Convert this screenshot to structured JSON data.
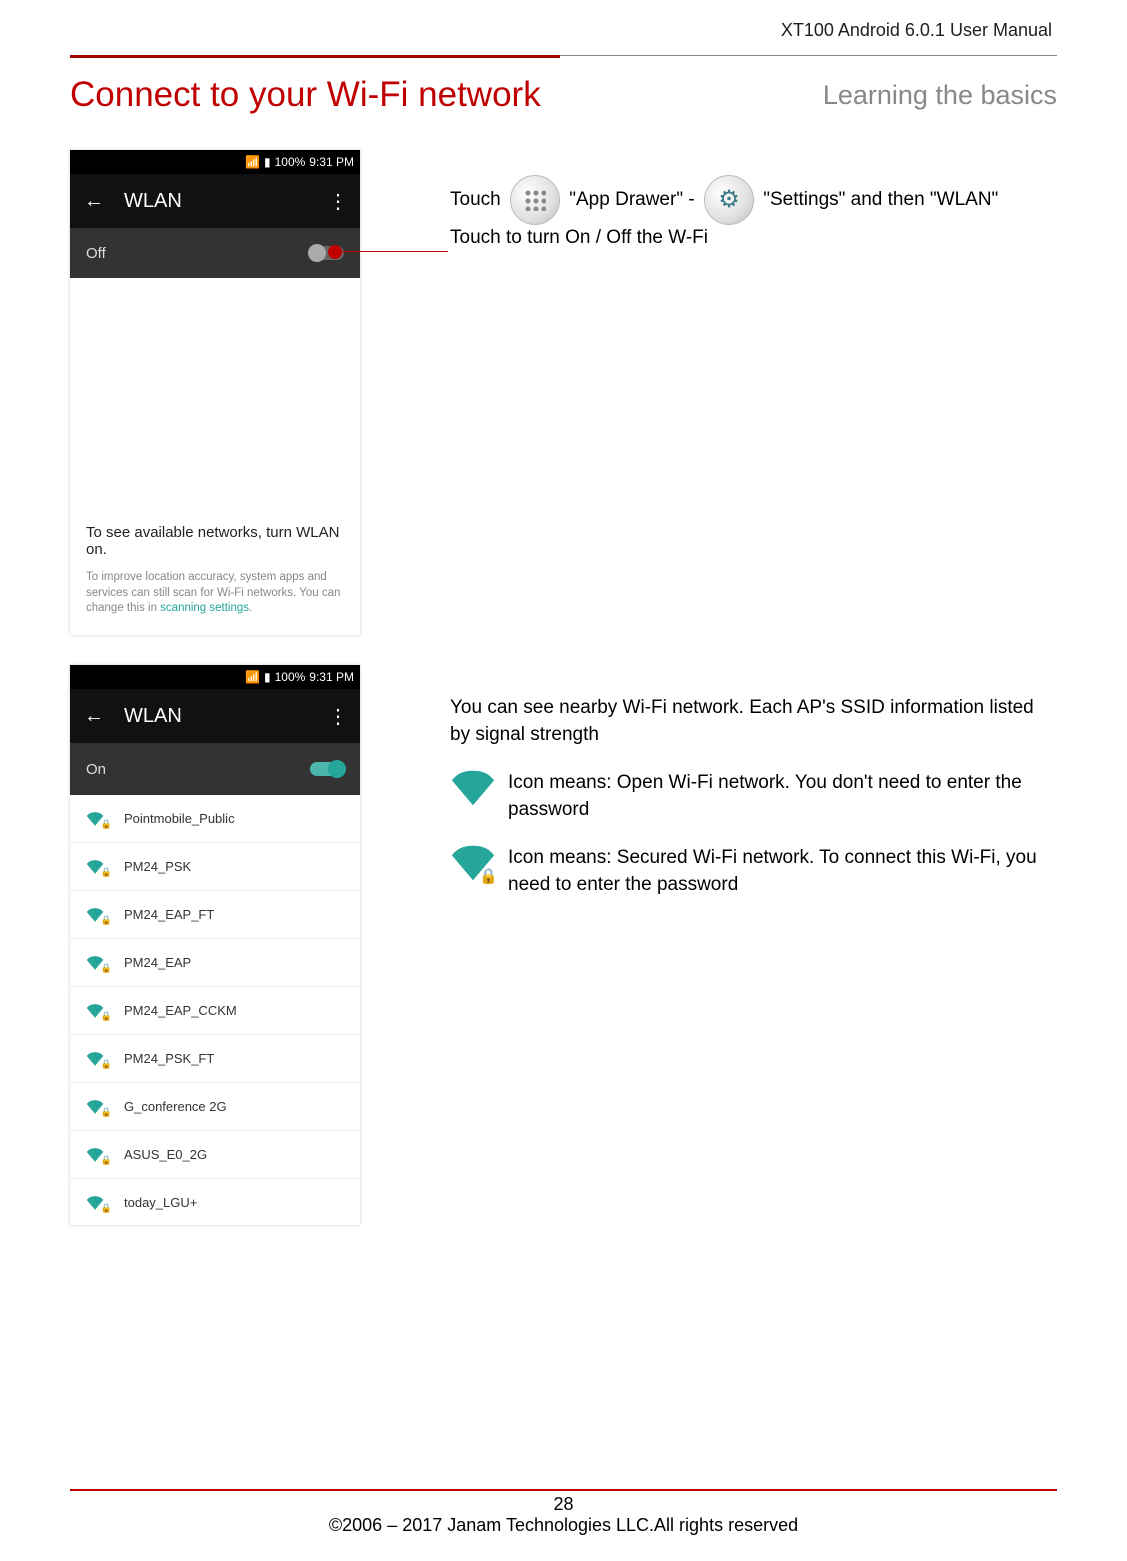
{
  "header": {
    "doc_title": "XT100 Android 6.0.1 User Manual"
  },
  "title": {
    "main": "Connect to your Wi-Fi network",
    "sub": "Learning the basics"
  },
  "phone1": {
    "status_time": "9:31 PM",
    "status_batt": "100%",
    "toolbar_title": "WLAN",
    "off_label": "Off",
    "msg1": "To see available networks, turn WLAN on.",
    "msg2a": "To improve location accuracy, system apps and services can still scan for Wi-Fi networks. You can change this in ",
    "msg2b": "scanning settings",
    "msg2c": "."
  },
  "instr1": {
    "t1": "Touch ",
    "t2": " \"App Drawer\" - ",
    "t3": " \"Settings\" and then \"WLAN\"",
    "t4": "Touch to turn On / Off the W-Fi"
  },
  "phone2": {
    "status_time": "9:31 PM",
    "status_batt": "100%",
    "toolbar_title": "WLAN",
    "on_label": "On",
    "networks": [
      {
        "name": "Pointmobile_Public",
        "secured": true
      },
      {
        "name": "PM24_PSK",
        "secured": true
      },
      {
        "name": "PM24_EAP_FT",
        "secured": true
      },
      {
        "name": "PM24_EAP",
        "secured": true
      },
      {
        "name": "PM24_EAP_CCKM",
        "secured": true
      },
      {
        "name": "PM24_PSK_FT",
        "secured": true
      },
      {
        "name": "G_conference 2G",
        "secured": true
      },
      {
        "name": "ASUS_E0_2G",
        "secured": true
      },
      {
        "name": "today_LGU+",
        "secured": true
      }
    ]
  },
  "instr2": {
    "p1": "You can see nearby Wi-Fi network. Each AP's SSID information listed by signal strength",
    "open_desc": "Icon means: Open Wi-Fi network. You don't need to enter the password",
    "sec_desc": "Icon means: Secured Wi-Fi network. To connect this Wi-Fi, you need to enter the password"
  },
  "footer": {
    "page": "28",
    "copyright": "©2006 – 2017 Janam Technologies LLC.All rights reserved"
  }
}
